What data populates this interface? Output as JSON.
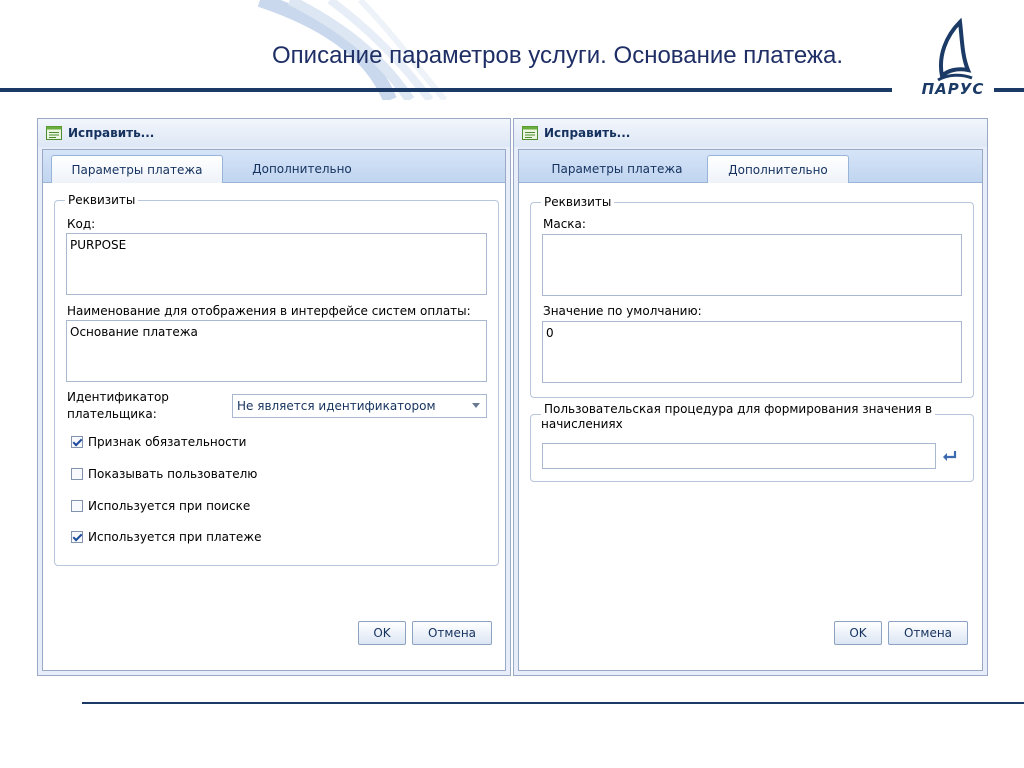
{
  "slide": {
    "title": "Описание параметров услуги. Основание платежа.",
    "logo_text": "ПАРУС"
  },
  "left_dialog": {
    "title": "Исправить...",
    "tabs": [
      {
        "label": "Параметры платежа",
        "active": true
      },
      {
        "label": "Дополнительно",
        "active": false
      }
    ],
    "group_legend": "Реквизиты",
    "code_label": "Код:",
    "code_value": "PURPOSE",
    "name_label": "Наименование для отображения в интерфейсе систем оплаты:",
    "name_value": "Основание платежа",
    "payer_id_label_1": "Идентификатор",
    "payer_id_label_2": "плательщика:",
    "payer_id_value": "Не является идентификатором",
    "checkboxes": [
      {
        "label": "Признак обязательности",
        "checked": true
      },
      {
        "label": "Показывать пользователю",
        "checked": false
      },
      {
        "label": "Используется при поиске",
        "checked": false
      },
      {
        "label": "Используется при платеже",
        "checked": true
      }
    ],
    "ok_label": "OK",
    "cancel_label": "Отмена"
  },
  "right_dialog": {
    "title": "Исправить...",
    "tabs": [
      {
        "label": "Параметры платежа",
        "active": false
      },
      {
        "label": "Дополнительно",
        "active": true
      }
    ],
    "group_legend": "Реквизиты",
    "mask_label": "Маска:",
    "mask_value": "",
    "default_label": "Значение по умолчанию:",
    "default_value": "0",
    "procedure_legend_1": "Пользовательская процедура для формирования значения в",
    "procedure_legend_2": "начислениях",
    "procedure_value": "",
    "ok_label": "OK",
    "cancel_label": "Отмена"
  },
  "colors": {
    "title_text": "#1f2f66",
    "rule": "#1b3a66",
    "dialog_bg": "#e7eef9",
    "tab_strip": "#c0d5f0"
  }
}
